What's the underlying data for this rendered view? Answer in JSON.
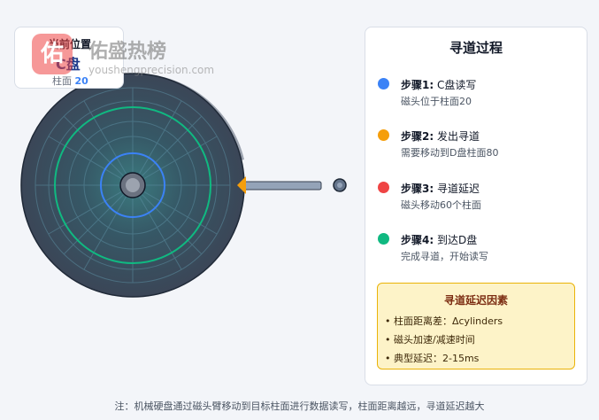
{
  "position": {
    "title": "当前位置",
    "disk": "C盘",
    "cylinder_label": "柱面",
    "cylinder_value": "20"
  },
  "watermark": {
    "logo_char": "佑",
    "brand": "佑盛热榜",
    "url": "youshengprecision.com"
  },
  "panel": {
    "title": "寻道过程",
    "steps": [
      {
        "label": "步骤1:",
        "text": "C盘读写",
        "desc": "磁头位于柱面20",
        "color": "#3b82f6"
      },
      {
        "label": "步骤2:",
        "text": "发出寻道",
        "desc": "需要移动到D盘柱面80",
        "color": "#f59e0b"
      },
      {
        "label": "步骤3:",
        "text": "寻道延迟",
        "desc": "磁头移动60个柱面",
        "color": "#ef4444"
      },
      {
        "label": "步骤4:",
        "text": "到达D盘",
        "desc": "完成寻道，开始读写",
        "color": "#10b981"
      }
    ],
    "factors": {
      "title": "寻道延迟因素",
      "items": [
        "• 柱面距离差：Δcylinders",
        "• 磁头加速/减速时间",
        "• 典型延迟：2-15ms"
      ]
    }
  },
  "note": "注：机械硬盘通过磁头臂移动到目标柱面进行数据读写，柱面距离越远，寻道延迟越大",
  "colors": {
    "platter": "#374151",
    "track_blue": "#3b82f6",
    "track_green": "#10b981",
    "arm": "#94a3b8",
    "head": "#f59e0b"
  }
}
